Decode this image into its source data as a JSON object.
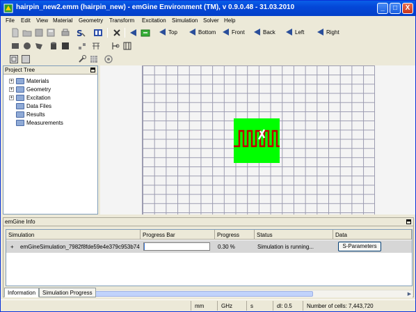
{
  "window": {
    "title": "hairpin_new2.emm (hairpin_new) - emGine Environment (TM), v 0.9.0.48 - 31.03.2010",
    "controls": {
      "minimize": "_",
      "maximize": "□",
      "close": "X"
    }
  },
  "menu": [
    "File",
    "Edit",
    "View",
    "Material",
    "Geometry",
    "Transform",
    "Excitation",
    "Simulation",
    "Solver",
    "Help"
  ],
  "view_buttons": {
    "top": "Top",
    "bottom": "Bottom",
    "front": "Front",
    "back": "Back",
    "left": "Left",
    "right": "Right"
  },
  "project_tree": {
    "title": "Project Tree",
    "items": [
      {
        "label": "Materials",
        "expandable": true
      },
      {
        "label": "Geometry",
        "expandable": true
      },
      {
        "label": "Excitation",
        "expandable": true
      },
      {
        "label": "Data Files",
        "expandable": false
      },
      {
        "label": "Results",
        "expandable": false
      },
      {
        "label": "Measurements",
        "expandable": false
      }
    ],
    "expand_symbol": "+"
  },
  "canvas": {
    "background": "#f4f4f4",
    "model_color": "#00ff00",
    "trace_color": "#c00000"
  },
  "info_panel": {
    "title": "emGine Info",
    "columns": [
      "Simulation",
      "Progress Bar",
      "Progress",
      "Status",
      "Data"
    ],
    "rows": [
      {
        "simulation": "emGineSimulation_7982f8fde59e4e379c953b74",
        "progress_fraction": 0.003,
        "progress": "0.30 %",
        "status": "Simulation is running...",
        "data_button": "S-Parameters"
      }
    ],
    "tabs": [
      "Information",
      "Simulation Progress"
    ]
  },
  "status_bar": {
    "unit_length": "mm",
    "unit_freq": "GHz",
    "unit_time": "s",
    "dl": "dl: 0.5",
    "cells": "Number of cells: 7,443,720"
  }
}
